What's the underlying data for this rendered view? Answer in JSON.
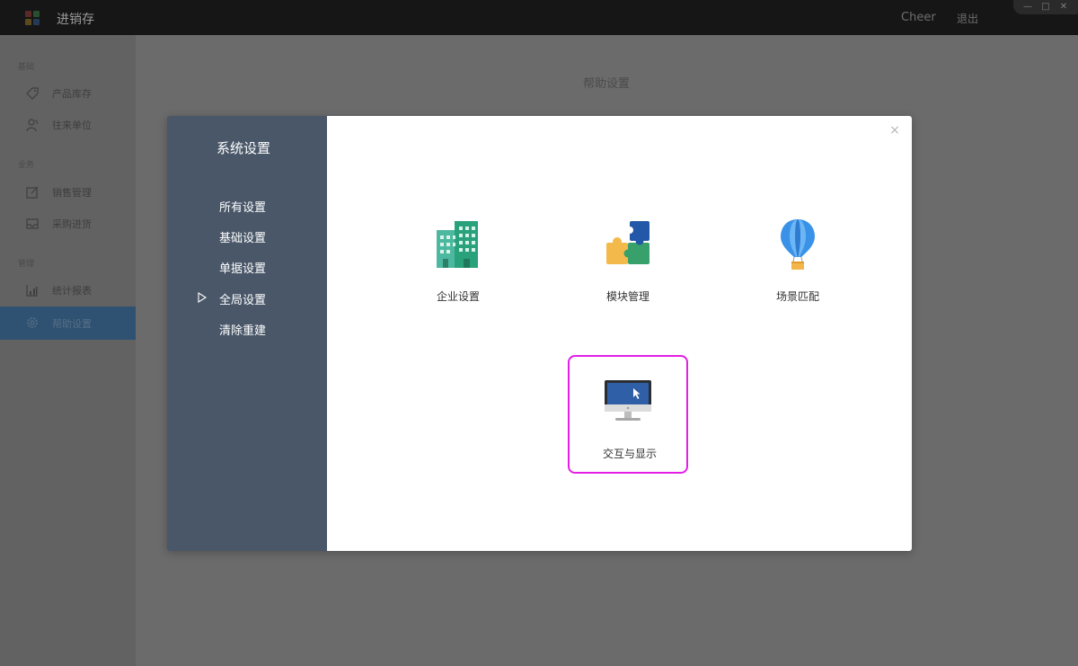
{
  "titlebar": {
    "app_name": "进销存",
    "user": "Cheer",
    "logout": "退出",
    "logo_colors": [
      "#d23a3a",
      "#3aa04a",
      "#f0a91c",
      "#2f7ed8"
    ]
  },
  "sidebar": {
    "groups": [
      "基础",
      "业务",
      "管理"
    ],
    "items": [
      {
        "label": "产品库存",
        "icon": "tag-icon"
      },
      {
        "label": "往来单位",
        "icon": "users-icon"
      },
      {
        "label": "销售管理",
        "icon": "edit-icon"
      },
      {
        "label": "采购进货",
        "icon": "inbox-icon"
      },
      {
        "label": "统计报表",
        "icon": "bar-chart-icon"
      },
      {
        "label": "帮助设置",
        "icon": "gear-icon",
        "active": true
      }
    ]
  },
  "main": {
    "page_title": "帮助设置"
  },
  "dialog": {
    "title": "系统设置",
    "menu": [
      {
        "label": "所有设置"
      },
      {
        "label": "基础设置"
      },
      {
        "label": "单据设置"
      },
      {
        "label": "全局设置",
        "current": true
      },
      {
        "label": "清除重建"
      }
    ],
    "close_symbol": "×",
    "tiles": [
      {
        "label": "企业设置",
        "icon": "building-icon"
      },
      {
        "label": "模块管理",
        "icon": "puzzle-icon"
      },
      {
        "label": "场景匹配",
        "icon": "hot-air-balloon-icon"
      },
      {
        "label": "交互与显示",
        "icon": "monitor-icon",
        "selected": true
      }
    ],
    "colors": {
      "side_bg": "#495769",
      "highlight": "#e51ee5"
    }
  }
}
